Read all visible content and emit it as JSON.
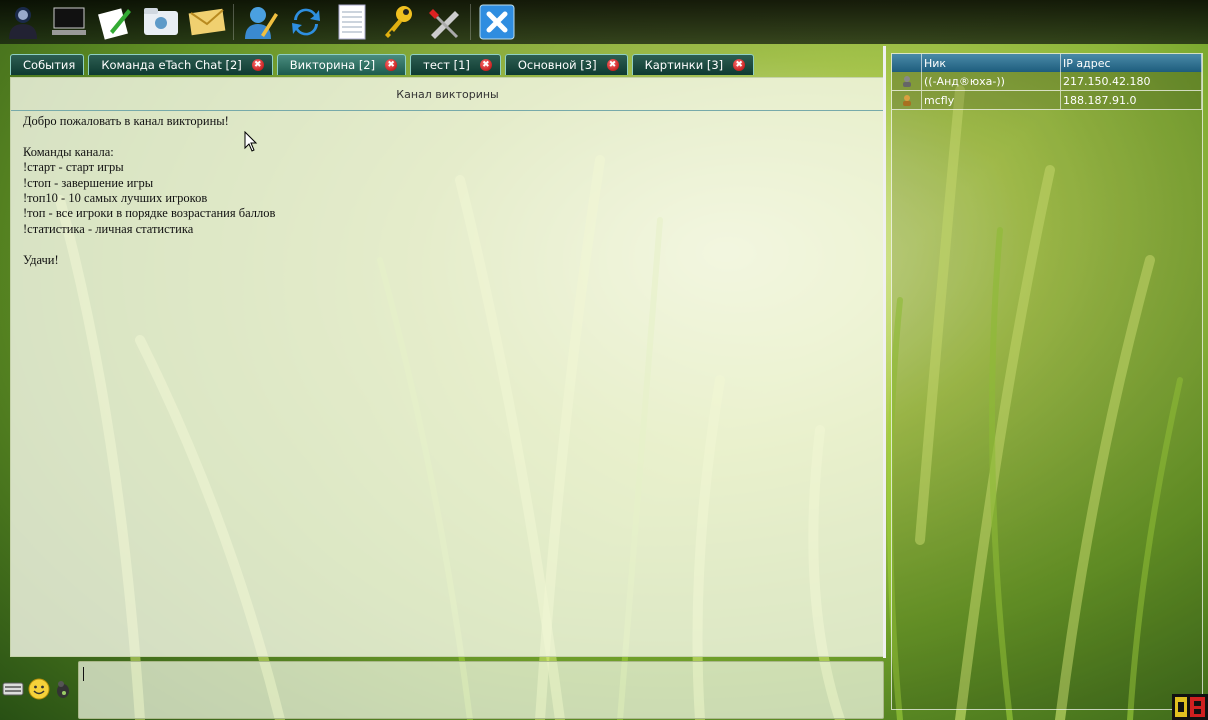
{
  "toolbar": {
    "buttons": [
      {
        "name": "user-profile",
        "icon": "user-icon"
      },
      {
        "name": "screen",
        "icon": "monitor-icon"
      },
      {
        "name": "compose",
        "icon": "edit-icon"
      },
      {
        "name": "folder",
        "icon": "folder-icon"
      },
      {
        "name": "mail",
        "icon": "mail-icon"
      },
      {
        "name": "user-edit",
        "icon": "user-edit-icon"
      },
      {
        "name": "refresh",
        "icon": "refresh-icon"
      },
      {
        "name": "notes",
        "icon": "notepad-icon"
      },
      {
        "name": "key",
        "icon": "key-icon"
      },
      {
        "name": "tools",
        "icon": "tools-icon"
      },
      {
        "name": "exit",
        "icon": "close-icon"
      }
    ]
  },
  "tabs": [
    {
      "label": "События",
      "closable": false,
      "active": false
    },
    {
      "label": "Команда eTach Chat [2]",
      "closable": true,
      "active": false
    },
    {
      "label": "Викторина [2]",
      "closable": true,
      "active": true
    },
    {
      "label": "тест [1]",
      "closable": true,
      "active": false
    },
    {
      "label": "Основной [3]",
      "closable": true,
      "active": false
    },
    {
      "label": "Картинки [3]",
      "closable": true,
      "active": false
    }
  ],
  "tab_close_glyph": "✖",
  "chat": {
    "header": "Канал викторины",
    "lines": [
      "Добро пожаловать в канал викторины!",
      "",
      "Команды канала:",
      "!старт - старт игры",
      "!стоп - завершение игры",
      "!топ10 - 10 самых лучших игроков",
      "!топ - все игроки в порядке возрастания баллов",
      "!статистика - личная статистика",
      "",
      "Удачи!"
    ]
  },
  "users": {
    "columns": {
      "nick": "Ник",
      "ip": "IP адрес"
    },
    "rows": [
      {
        "nick": "((-Анд®юха-))",
        "ip": "217.150.42.180"
      },
      {
        "nick": "mcfly",
        "ip": "188.187.91.0"
      }
    ]
  },
  "colors": {
    "tab_bg": "#0e3a31",
    "tab_border": "#8fd0c4",
    "header_blue": "#1e5d7d",
    "close_red": "#b00000"
  }
}
